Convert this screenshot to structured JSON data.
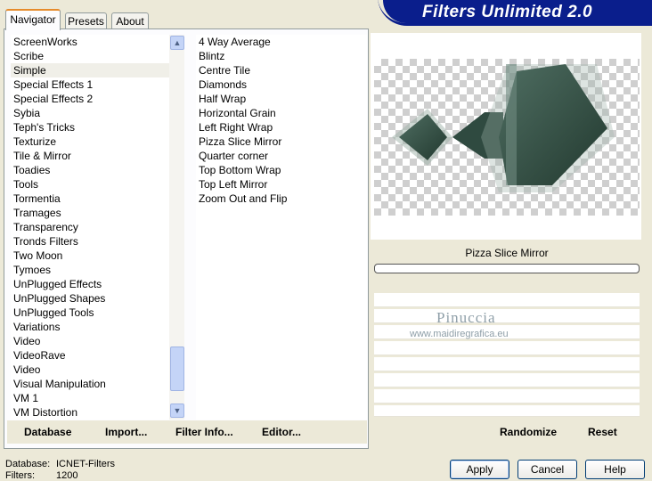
{
  "tabs": [
    "Navigator",
    "Presets",
    "About"
  ],
  "banner_title": "Filters Unlimited 2.0",
  "categories": [
    "ScreenWorks",
    "Scribe",
    "Simple",
    "Special Effects 1",
    "Special Effects 2",
    "Sybia",
    "Teph's Tricks",
    "Texturize",
    "Tile & Mirror",
    "Toadies",
    "Tools",
    "Tormentia",
    "Tramages",
    "Transparency",
    "Tronds Filters",
    "Two Moon",
    "Tymoes",
    "UnPlugged Effects",
    "UnPlugged Shapes",
    "UnPlugged Tools",
    "Variations",
    "Video",
    "VideoRave",
    "Video",
    "Visual Manipulation",
    "VM 1",
    "VM Distortion"
  ],
  "selected_category": "Simple",
  "filters": [
    "4 Way Average",
    "Blintz",
    "Centre Tile",
    "Diamonds",
    "Half Wrap",
    "Horizontal Grain",
    "Left Right Wrap",
    "Pizza Slice Mirror",
    "Quarter corner",
    "Top Bottom Wrap",
    "Top Left Mirror",
    "Zoom Out and Flip"
  ],
  "selected_filter": "Pizza Slice Mirror",
  "filter_name": "Pizza Slice Mirror",
  "bottom_links": {
    "database": "Database",
    "import": "Import...",
    "filter_info": "Filter Info...",
    "editor": "Editor...",
    "randomize": "Randomize",
    "reset": "Reset"
  },
  "watermark": {
    "name": "Pinuccia",
    "url": "www.maidiregrafica.eu"
  },
  "status": {
    "database_label": "Database:",
    "database_value": "ICNET-Filters",
    "filters_label": "Filters:",
    "filters_value": "1200"
  },
  "buttons": {
    "apply": "Apply",
    "cancel": "Cancel",
    "help": "Help"
  },
  "colors": {
    "accent": "#316ac5",
    "banner": "#0a1e8c",
    "preview_shape": "#2f4a40"
  }
}
